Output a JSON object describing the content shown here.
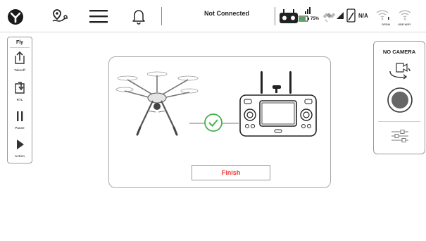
{
  "topbar": {
    "connection_status": "Not Connected",
    "battery_percent": "75%",
    "na_label": "N/A",
    "ofdm_label": "OFDM",
    "usb_wifi_label": "USB WIFI"
  },
  "left_panel": {
    "title": "Fly",
    "buttons": [
      {
        "label": "Takeoff",
        "icon": "takeoff-icon"
      },
      {
        "label": "RTL",
        "icon": "rtl-icon"
      },
      {
        "label": "Pause",
        "icon": "pause-icon"
      },
      {
        "label": "Action",
        "icon": "play-icon"
      }
    ]
  },
  "dialog": {
    "finish_label": "Finish",
    "images": [
      "drone-illustration",
      "check-circle-icon",
      "remote-controller-illustration"
    ]
  },
  "right_panel": {
    "title": "NO CAMERA",
    "icons": [
      "switch-camera-icon",
      "record-button",
      "settings-sliders-icon"
    ]
  },
  "colors": {
    "accent_green": "#43b049",
    "finish_red": "#e53935",
    "record_gray": "#666666"
  }
}
